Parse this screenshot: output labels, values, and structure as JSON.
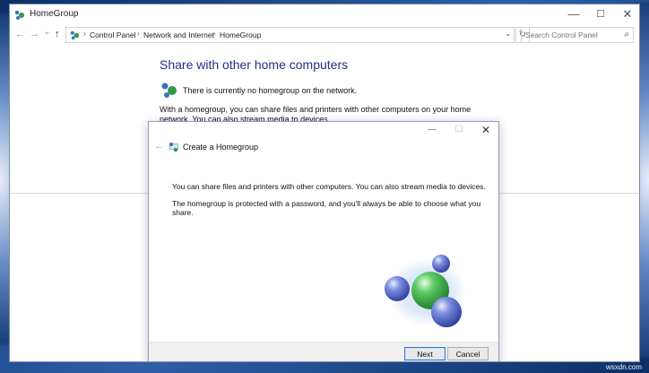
{
  "window": {
    "title": "HomeGroup",
    "controls": {
      "minimize": "—",
      "maximize": "☐",
      "close": "✕"
    }
  },
  "navbar": {
    "back": "←",
    "forward": "→",
    "recent": "⌄",
    "up": "↑",
    "breadcrumb": [
      "Control Panel",
      "Network and Internet",
      "HomeGroup"
    ],
    "separator": "›",
    "dropdown": "⌄",
    "refresh": "↻",
    "search_placeholder": "Search Control Panel",
    "search_icon": "⌕"
  },
  "main": {
    "heading": "Share with other home computers",
    "status": "There is currently no homegroup on the network.",
    "info": "With a homegroup, you can share files and printers with other computers on your home network. You can also stream media to devices."
  },
  "dialog": {
    "title": "Create a Homegroup",
    "back": "←",
    "controls": {
      "minimize": "—",
      "maximize": "☐",
      "close": "✕"
    },
    "para1": "You can share files and printers with other computers. You can also stream media to devices.",
    "para2": "The homegroup is protected with a password, and you'll always be able to choose what you share.",
    "next_label": "Next",
    "cancel_label": "Cancel"
  },
  "watermark": "wsxdn.com",
  "colors": {
    "heading": "#1e3287",
    "accent": "#2f78d2"
  }
}
